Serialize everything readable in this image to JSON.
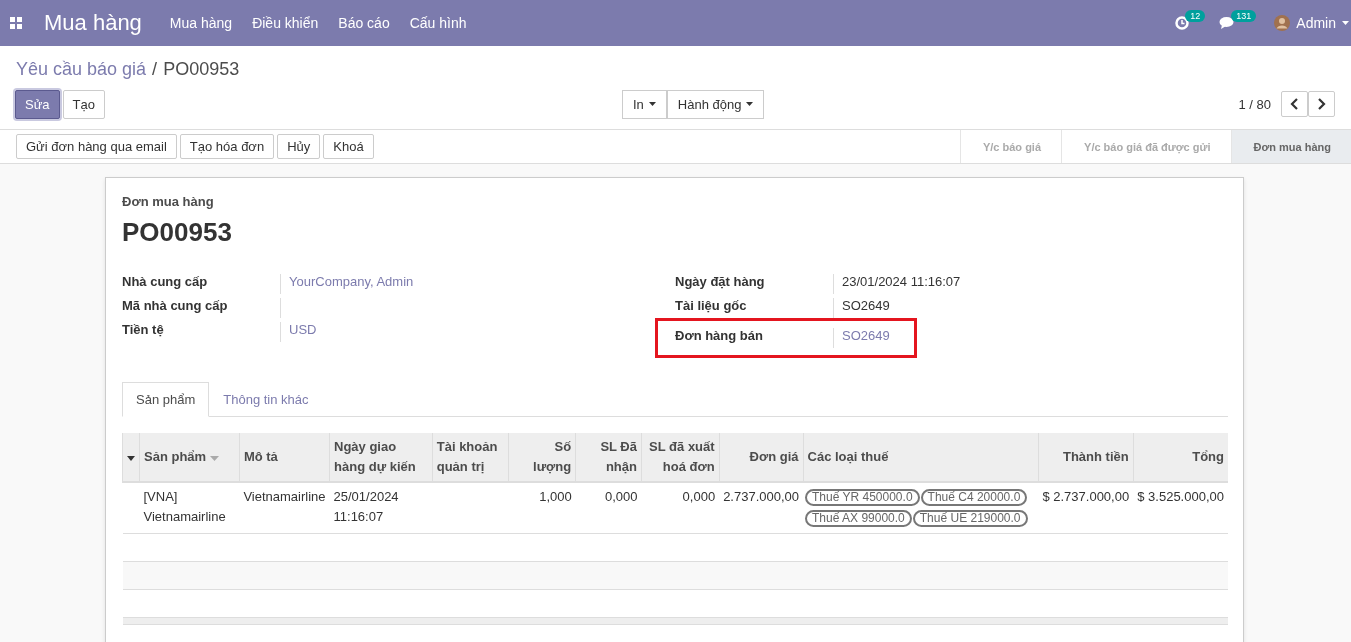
{
  "app": {
    "title": "Mua hàng",
    "menu": [
      "Mua hàng",
      "Điều khiển",
      "Báo cáo",
      "Cấu hình"
    ],
    "activity_count": "12",
    "message_count": "131",
    "user": "Admin"
  },
  "breadcrumb_separator": "/",
  "breadcrumb": [
    {
      "label": "Yêu cầu báo giá",
      "kind": "link"
    },
    {
      "label": "PO00953",
      "kind": "current"
    }
  ],
  "buttons": [
    {
      "label": "Sửa",
      "primary": true
    },
    {
      "label": "Tạo",
      "primary": false
    }
  ],
  "dropdowns": [
    "In",
    "Hành động"
  ],
  "pager": "1 / 80",
  "actions": [
    "Gửi đơn hàng qua email",
    "Tạo hóa đơn",
    "Hủy",
    "Khoá"
  ],
  "stages": [
    {
      "label": "Y/c báo giá",
      "selected": false
    },
    {
      "label": "Y/c báo giá đã được gửi",
      "selected": false
    },
    {
      "label": "Đơn mua hàng",
      "selected": true
    }
  ],
  "form": {
    "caption": "Đơn mua hàng",
    "name": "PO00953",
    "left_fields": [
      {
        "label": "Nhà cung cấp",
        "value": "YourCompany, Admin",
        "link": true,
        "highlighted": false
      },
      {
        "label": "Mã nhà cung cấp",
        "highlighted": false
      },
      {
        "label": "Tiền tệ",
        "value": "USD",
        "link": true,
        "highlighted": false
      }
    ],
    "right_fields": [
      {
        "label": "Ngày đặt hàng",
        "value": "23/01/2024 11:16:07",
        "link": false,
        "highlighted": false
      },
      {
        "label": "Tài liệu gốc",
        "value": "SO2649",
        "link": false,
        "highlighted": false
      },
      {
        "label": "Đơn hàng bán",
        "value": "SO2649",
        "link": true,
        "highlighted": true
      }
    ]
  },
  "tabs": [
    {
      "label": "Sản phẩm",
      "selected": true
    },
    {
      "label": "Thông tin khác",
      "selected": false
    }
  ],
  "table": {
    "columns": [
      {
        "label": "Sản phẩm",
        "kind": "text",
        "sorted": true
      },
      {
        "label": "Mô tả",
        "kind": "text",
        "sorted": false
      },
      {
        "label": "Ngày giao hàng dự kiến",
        "kind": "text",
        "sorted": false
      },
      {
        "label": "Tài khoản quản trị",
        "kind": "text",
        "sorted": false
      },
      {
        "label": "Số lượng",
        "kind": "number",
        "sorted": false
      },
      {
        "label": "SL Đã nhận",
        "kind": "number",
        "sorted": false
      },
      {
        "label": "SL đã xuất hoá đơn",
        "kind": "number",
        "sorted": false
      },
      {
        "label": "Đơn giá",
        "kind": "number",
        "sorted": false
      },
      {
        "label": "Các loại thuế",
        "kind": "tags",
        "sorted": false
      },
      {
        "label": "Thành tiền",
        "kind": "number",
        "sorted": false
      },
      {
        "label": "Tổng",
        "kind": "number",
        "sorted": false
      }
    ],
    "rows": [
      {
        "cells": [
          "[VNA] Vietnamairline",
          "Vietnamairline",
          "25/01/2024 11:16:07",
          "",
          "1,000",
          "0,000",
          "0,000",
          "2.737.000,00",
          [
            "Thuế YR 450000.0",
            "Thuế C4 20000.0",
            "Thuế AX 99000.0",
            "Thuế UE 219000.0"
          ],
          "$ 2.737.000,00",
          "$ 3.525.000,00"
        ]
      }
    ]
  }
}
